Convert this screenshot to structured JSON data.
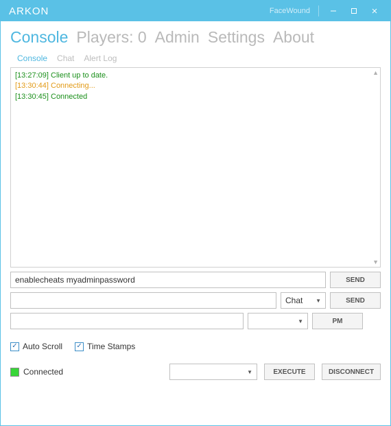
{
  "titlebar": {
    "app_name": "ARKON",
    "username": "FaceWound"
  },
  "main_tabs": {
    "console": "Console",
    "players": "Players: 0",
    "admin": "Admin",
    "settings": "Settings",
    "about": "About"
  },
  "sub_tabs": {
    "console": "Console",
    "chat": "Chat",
    "alert_log": "Alert Log"
  },
  "log": [
    {
      "ts": "[13:27:09]",
      "msg": "Client up to date.",
      "color": "green"
    },
    {
      "ts": "[13:30:44]",
      "msg": "Connecting...",
      "color": "orange"
    },
    {
      "ts": "[13:30:45]",
      "msg": "Connected",
      "color": "green"
    }
  ],
  "inputs": {
    "command_value": "enablecheats myadminpassword",
    "chat_value": "",
    "pm_value": "",
    "chat_dd": "Chat",
    "pm_dd": "",
    "exec_dd": ""
  },
  "buttons": {
    "send1": "SEND",
    "send2": "SEND",
    "pm": "PM",
    "execute": "EXECUTE",
    "disconnect": "DISCONNECT"
  },
  "checks": {
    "auto_scroll": "Auto Scroll",
    "time_stamps": "Time Stamps"
  },
  "status": {
    "label": "Connected",
    "color": "#37d637"
  }
}
